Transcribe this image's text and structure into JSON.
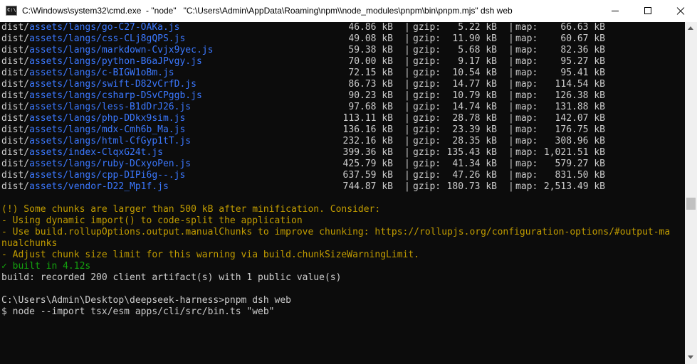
{
  "window": {
    "title": "C:\\Windows\\system32\\cmd.exe  - \"node\"   \"C:\\Users\\Admin\\AppData\\Roaming\\npm\\\\node_modules\\pnpm\\bin\\pnpm.mjs\" dsh web",
    "app_icon_text": "C:\\",
    "minimize_icon": "minimize-icon",
    "maximize_icon": "maximize-icon",
    "close_icon": "close-icon"
  },
  "colors": {
    "background": "#0c0c0c",
    "text": "#cccccc",
    "path_blue": "#3b78ff",
    "warning_yellow": "#c19c00",
    "success_green": "#13a10e"
  },
  "build_rows": [
    {
      "dir": "dist/",
      "file": "assets/langs/go-C27-OAKa.js",
      "size": "46.86 kB",
      "gzip_label": "gzip:",
      "gzip": "5.22 kB",
      "map_label": "map:",
      "map": "66.63 kB"
    },
    {
      "dir": "dist/",
      "file": "assets/langs/css-CLj8gQPS.js",
      "size": "49.08 kB",
      "gzip_label": "gzip:",
      "gzip": "11.90 kB",
      "map_label": "map:",
      "map": "60.67 kB"
    },
    {
      "dir": "dist/",
      "file": "assets/langs/markdown-Cvjx9yec.js",
      "size": "59.38 kB",
      "gzip_label": "gzip:",
      "gzip": "5.68 kB",
      "map_label": "map:",
      "map": "82.36 kB"
    },
    {
      "dir": "dist/",
      "file": "assets/langs/python-B6aJPvgy.js",
      "size": "70.00 kB",
      "gzip_label": "gzip:",
      "gzip": "9.17 kB",
      "map_label": "map:",
      "map": "95.27 kB"
    },
    {
      "dir": "dist/",
      "file": "assets/langs/c-BIGW1oBm.js",
      "size": "72.15 kB",
      "gzip_label": "gzip:",
      "gzip": "10.54 kB",
      "map_label": "map:",
      "map": "95.41 kB"
    },
    {
      "dir": "dist/",
      "file": "assets/langs/swift-D82vCrfD.js",
      "size": "86.73 kB",
      "gzip_label": "gzip:",
      "gzip": "14.77 kB",
      "map_label": "map:",
      "map": "114.54 kB"
    },
    {
      "dir": "dist/",
      "file": "assets/langs/csharp-DSvCPggb.js",
      "size": "90.23 kB",
      "gzip_label": "gzip:",
      "gzip": "10.79 kB",
      "map_label": "map:",
      "map": "126.38 kB"
    },
    {
      "dir": "dist/",
      "file": "assets/langs/less-B1dDrJ26.js",
      "size": "97.68 kB",
      "gzip_label": "gzip:",
      "gzip": "14.74 kB",
      "map_label": "map:",
      "map": "131.88 kB"
    },
    {
      "dir": "dist/",
      "file": "assets/langs/php-DDkx9sim.js",
      "size": "113.11 kB",
      "gzip_label": "gzip:",
      "gzip": "28.78 kB",
      "map_label": "map:",
      "map": "142.07 kB"
    },
    {
      "dir": "dist/",
      "file": "assets/langs/mdx-Cmh6b_Ma.js",
      "size": "136.16 kB",
      "gzip_label": "gzip:",
      "gzip": "23.39 kB",
      "map_label": "map:",
      "map": "176.75 kB"
    },
    {
      "dir": "dist/",
      "file": "assets/langs/html-CfGyp1tT.js",
      "size": "232.16 kB",
      "gzip_label": "gzip:",
      "gzip": "28.35 kB",
      "map_label": "map:",
      "map": "308.96 kB"
    },
    {
      "dir": "dist/",
      "file": "assets/index-ClqxG24t.js",
      "size": "399.36 kB",
      "gzip_label": "gzip:",
      "gzip": "135.43 kB",
      "map_label": "map:",
      "map": "1,021.51 kB"
    },
    {
      "dir": "dist/",
      "file": "assets/langs/ruby-DCxyoPen.js",
      "size": "425.79 kB",
      "gzip_label": "gzip:",
      "gzip": "41.34 kB",
      "map_label": "map:",
      "map": "579.27 kB"
    },
    {
      "dir": "dist/",
      "file": "assets/langs/cpp-DIPi6g--.js",
      "size": "637.59 kB",
      "gzip_label": "gzip:",
      "gzip": "47.26 kB",
      "map_label": "map:",
      "map": "831.50 kB"
    },
    {
      "dir": "dist/",
      "file": "assets/vendor-D22_Mp1f.js",
      "size": "744.87 kB",
      "gzip_label": "gzip:",
      "gzip": "180.73 kB",
      "map_label": "map:",
      "map": "2,513.49 kB"
    }
  ],
  "column_separator": "|",
  "warning_lines": [
    "(!) Some chunks are larger than 500 kB after minification. Consider:",
    "- Using dynamic import() to code-split the application",
    "- Use build.rollupOptions.output.manualChunks to improve chunking: https://rollupjs.org/configuration-options/#output-ma",
    "nualchunks",
    "- Adjust chunk size limit for this warning via build.chunkSizeWarningLimit."
  ],
  "built": {
    "check": "✓",
    "text": " built in 4.12s"
  },
  "artifacts_line": "build: recorded 200 client artifact(s) with 1 public value(s)",
  "prompt_line": "C:\\Users\\Admin\\Desktop\\deepseek-harness>pnpm dsh web",
  "command_line": "$ node --import tsx/esm apps/cli/src/bin.ts \"web\""
}
